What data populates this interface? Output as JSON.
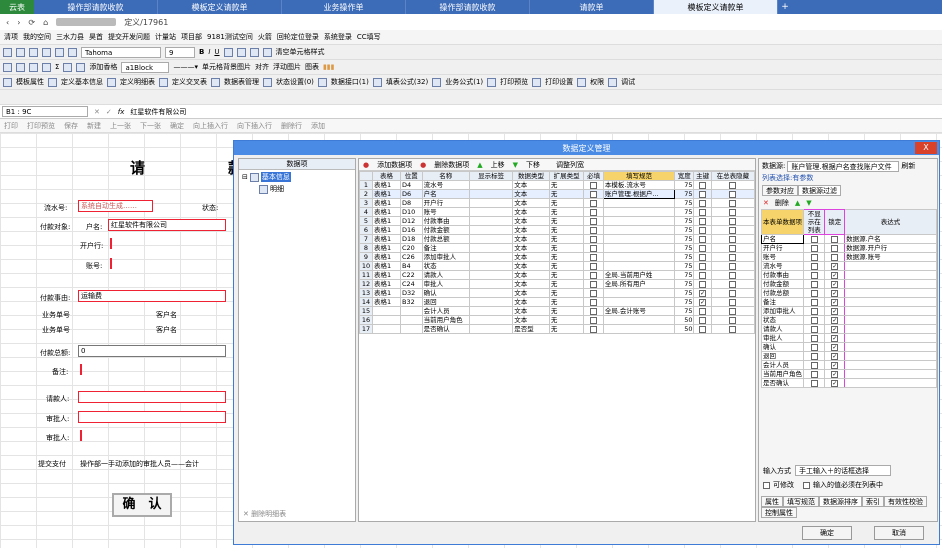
{
  "tabs": {
    "home": "云表",
    "items": [
      "操作部请款收款",
      "模板定义请款单",
      "业务操作单",
      "操作部请款收款",
      "请款单",
      "模板定义请款单"
    ],
    "plus": "+"
  },
  "address": {
    "path": "定义/17961"
  },
  "bookmarks": [
    "清项",
    "我的空间",
    "三水力县",
    "昊首",
    "提交开发问题",
    "计量站",
    "项目部",
    "9181测试空间",
    "火箭",
    "回轮定位登录",
    "系统登录",
    "CC填写"
  ],
  "toolbar1": {
    "font": "Tahoma",
    "size": "9",
    "bold": "B",
    "italic": "I",
    "underline": "U",
    "cell_style": "清空单元格样式"
  },
  "toolbar2": {
    "items": [
      "添加香格",
      "a1Block",
      "单元格背景图片",
      "对齐",
      "浮动图片",
      "图表"
    ]
  },
  "toolbar3": {
    "items": [
      "模板属性",
      "定义基本信息",
      "定义明细表",
      "定义交叉表",
      "数据表管理",
      "状态设置(0)",
      "数据接口(1)",
      "填表公式(32)",
      "业务公式(1)",
      "打印预览",
      "打印设置",
      "权限",
      "调试"
    ]
  },
  "formula_bar": {
    "cell_ref": "B1 : 9C",
    "fx": "fx",
    "value": "红星软件有限公司"
  },
  "action_bar": [
    "打印",
    "打印预览",
    "保存",
    "新建",
    "上一张",
    "下一张",
    "确定",
    "向上插入行",
    "向下插入行",
    "删除行",
    "添加"
  ],
  "form": {
    "title": "请　款",
    "serial_label": "流水号:",
    "serial_value": "系统自动生成……",
    "status_label": "状态:",
    "payee_label": "付款对象:",
    "acct_label": "户名:",
    "acct_value": "红星软件有限公司",
    "bank_label": "开户行:",
    "acctno_label": "账号:",
    "reason_label": "付款事由:",
    "reason_value": "运输费",
    "biz_no_label": "业务单号",
    "cust_label": "客户名",
    "biz_no2_label": "业务单号",
    "cust2_label": "客户名",
    "total_label": "付款总额:",
    "total_value": "0",
    "remark_label": "备注:",
    "requester_label": "请款人:",
    "approver_label": "审批人:",
    "reviewer_label": "审批人:",
    "flow_label": "提交支付",
    "flow_value": "操作部一手动添加的审批人员——会计",
    "confirm": "确　认"
  },
  "dialog": {
    "title": "数据定义管理",
    "close": "X",
    "left": {
      "header": "数据项",
      "tree_root": "基本信息",
      "tree_child": "明细",
      "delete": "删除明细表"
    },
    "mid": {
      "toolbar": [
        "添加数据项",
        "删除数据项",
        "上移",
        "下移",
        "调整列宽"
      ],
      "headers": [
        "",
        "表格",
        "位置",
        "名称",
        "显示标签",
        "数据类型",
        "扩展类型",
        "必填",
        "填写规范",
        "宽度",
        "主键",
        "在总表隐藏"
      ],
      "rows": [
        {
          "n": "1",
          "t": "表格1",
          "p": "D4",
          "name": "流水号",
          "type": "文本",
          "ext": "无",
          "req": false,
          "rule": "本模板.流水号",
          "w": "75",
          "pk": false
        },
        {
          "n": "2",
          "t": "表格1",
          "p": "D6",
          "name": "户名",
          "type": "文本",
          "ext": "无",
          "req": false,
          "rule": "账户管理.根据户...",
          "w": "75",
          "pk": false
        },
        {
          "n": "3",
          "t": "表格1",
          "p": "D8",
          "name": "开户行",
          "type": "文本",
          "ext": "无",
          "req": false,
          "rule": "",
          "w": "75",
          "pk": false
        },
        {
          "n": "4",
          "t": "表格1",
          "p": "D10",
          "name": "账号",
          "type": "文本",
          "ext": "无",
          "req": false,
          "rule": "",
          "w": "75",
          "pk": false
        },
        {
          "n": "5",
          "t": "表格1",
          "p": "D12",
          "name": "付款事由",
          "type": "文本",
          "ext": "无",
          "req": false,
          "rule": "",
          "w": "75",
          "pk": false
        },
        {
          "n": "6",
          "t": "表格1",
          "p": "D16",
          "name": "付款金额",
          "type": "文本",
          "ext": "无",
          "req": false,
          "rule": "",
          "w": "75",
          "pk": false
        },
        {
          "n": "7",
          "t": "表格1",
          "p": "D18",
          "name": "付款总额",
          "type": "文本",
          "ext": "无",
          "req": false,
          "rule": "",
          "w": "75",
          "pk": false
        },
        {
          "n": "8",
          "t": "表格1",
          "p": "C20",
          "name": "备注",
          "type": "文本",
          "ext": "无",
          "req": false,
          "rule": "",
          "w": "75",
          "pk": false
        },
        {
          "n": "9",
          "t": "表格1",
          "p": "C26",
          "name": "添加审批人",
          "type": "文本",
          "ext": "无",
          "req": false,
          "rule": "",
          "w": "75",
          "pk": false
        },
        {
          "n": "10",
          "t": "表格1",
          "p": "B4",
          "name": "状态",
          "type": "文本",
          "ext": "无",
          "req": false,
          "rule": "",
          "w": "75",
          "pk": false
        },
        {
          "n": "11",
          "t": "表格1",
          "p": "C22",
          "name": "请款人",
          "type": "文本",
          "ext": "无",
          "req": false,
          "rule": "全局.当前用户姓",
          "w": "75",
          "pk": false
        },
        {
          "n": "12",
          "t": "表格1",
          "p": "C24",
          "name": "审批人",
          "type": "文本",
          "ext": "无",
          "req": false,
          "rule": "全局.所有用户",
          "w": "75",
          "pk": false
        },
        {
          "n": "13",
          "t": "表格1",
          "p": "D32",
          "name": "确认",
          "type": "文本",
          "ext": "无",
          "req": false,
          "rule": "",
          "w": "75",
          "pk": true
        },
        {
          "n": "14",
          "t": "表格1",
          "p": "B32",
          "name": "退回",
          "type": "文本",
          "ext": "无",
          "req": false,
          "rule": "",
          "w": "75",
          "pk": true
        },
        {
          "n": "15",
          "t": "",
          "p": "",
          "name": "会计人员",
          "type": "文本",
          "ext": "无",
          "req": false,
          "rule": "全局.会计账号",
          "w": "75",
          "pk": false
        },
        {
          "n": "16",
          "t": "",
          "p": "",
          "name": "当前用户角色",
          "type": "文本",
          "ext": "无",
          "req": false,
          "rule": "",
          "w": "50",
          "pk": false
        },
        {
          "n": "17",
          "t": "",
          "p": "",
          "name": "是否确认",
          "type": "是否型",
          "ext": "无",
          "req": false,
          "rule": "",
          "w": "50",
          "pk": false
        }
      ]
    },
    "right": {
      "source_label": "数据源:",
      "source_value": "账户管理.根据户名查找账户文件",
      "refresh": "刷新",
      "filter": "列表选择:有参数",
      "tab1": "参数对应",
      "tab2": "数据源过滤",
      "delete": "删除",
      "headers": [
        "本表单数据项",
        "不显示在列表",
        "锁定",
        "表达式"
      ],
      "rows": [
        {
          "name": "户名",
          "hide": false,
          "lock": false,
          "expr": "数据源.户名"
        },
        {
          "name": "开户行",
          "hide": false,
          "lock": false,
          "expr": "数据源.开户行"
        },
        {
          "name": "账号",
          "hide": false,
          "lock": false,
          "expr": "数据源.账号"
        },
        {
          "name": "流水号",
          "hide": false,
          "lock": true,
          "expr": ""
        },
        {
          "name": "付款事由",
          "hide": false,
          "lock": true,
          "expr": ""
        },
        {
          "name": "付款金额",
          "hide": false,
          "lock": true,
          "expr": ""
        },
        {
          "name": "付款总额",
          "hide": false,
          "lock": true,
          "expr": ""
        },
        {
          "name": "备注",
          "hide": false,
          "lock": true,
          "expr": ""
        },
        {
          "name": "添加审批人",
          "hide": false,
          "lock": true,
          "expr": ""
        },
        {
          "name": "状态",
          "hide": false,
          "lock": true,
          "expr": ""
        },
        {
          "name": "请款人",
          "hide": false,
          "lock": true,
          "expr": ""
        },
        {
          "name": "审批人",
          "hide": false,
          "lock": true,
          "expr": ""
        },
        {
          "name": "确认",
          "hide": false,
          "lock": true,
          "expr": ""
        },
        {
          "name": "退回",
          "hide": false,
          "lock": true,
          "expr": ""
        },
        {
          "name": "会计人员",
          "hide": false,
          "lock": true,
          "expr": ""
        },
        {
          "name": "当前用户角色",
          "hide": false,
          "lock": true,
          "expr": ""
        },
        {
          "name": "是否确认",
          "hide": false,
          "lock": true,
          "expr": ""
        }
      ],
      "input_mode_label": "输入方式",
      "input_mode_value": "手工输入＋的话框选择",
      "sync": "可修改",
      "only_in_list": "输入的值必须在列表中",
      "bottom_tabs": [
        "属性",
        "填写规范",
        "数据源排序",
        "索引",
        "有效性校验",
        "控制属性"
      ]
    },
    "ok": "确定",
    "cancel": "取消"
  }
}
